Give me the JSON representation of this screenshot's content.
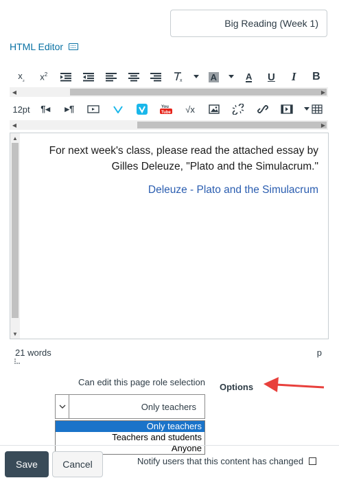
{
  "title_input": {
    "value": "Big Reading (Week 1)"
  },
  "html_editor_link": {
    "label": "HTML Editor",
    "icon": "keyboard-icon"
  },
  "toolbar1": {
    "buttons": [
      {
        "name": "bold-button",
        "label": "B"
      },
      {
        "name": "italic-button",
        "label": "I"
      },
      {
        "name": "underline-button",
        "label": "U"
      },
      {
        "name": "text-color-button",
        "label": "A"
      },
      {
        "name": "background-color-button",
        "label": "A"
      },
      {
        "name": "clear-formatting-button",
        "label": "Tx"
      },
      {
        "name": "align-right-button",
        "icon": "align-right-icon"
      },
      {
        "name": "align-center-button",
        "icon": "align-center-icon"
      },
      {
        "name": "align-left-button",
        "icon": "align-left-icon"
      },
      {
        "name": "outdent-button",
        "icon": "outdent-icon"
      },
      {
        "name": "indent-button",
        "icon": "indent-icon"
      },
      {
        "name": "superscript-button",
        "label": "x²"
      },
      {
        "name": "subscript-button",
        "label": "x₂"
      }
    ]
  },
  "toolbar2": {
    "font_size": "12pt",
    "buttons": [
      {
        "name": "table-button",
        "icon": "table-icon"
      },
      {
        "name": "media-button",
        "icon": "media-icon"
      },
      {
        "name": "link-button",
        "icon": "link-icon"
      },
      {
        "name": "unlink-button",
        "icon": "unlink-icon"
      },
      {
        "name": "image-button",
        "icon": "image-icon"
      },
      {
        "name": "equation-button",
        "label": "√x"
      },
      {
        "name": "youtube-button",
        "icon": "youtube-icon"
      },
      {
        "name": "vimeo-button",
        "icon": "vimeo-icon"
      },
      {
        "name": "vimeo-alt-button",
        "icon": "vimeo-v-icon"
      },
      {
        "name": "embed-button",
        "icon": "embed-icon"
      },
      {
        "name": "rtl-button",
        "icon": "rtl-icon"
      },
      {
        "name": "ltr-button",
        "icon": "ltr-icon"
      }
    ]
  },
  "editor": {
    "paragraph": "For next week's class, please read the attached essay by Gilles Deleuze, \"Plato and the Simulacrum.\"",
    "link": "Deleuze - Plato and the Simulacrum"
  },
  "statusbar": {
    "element_path": "p",
    "word_count": "21 words"
  },
  "options": {
    "label": "Options",
    "role_label": "Can edit this page role selection",
    "selected": "Only teachers",
    "choices": [
      "Only teachers",
      "Teachers and students",
      "Anyone"
    ]
  },
  "notify": {
    "label": "Notify users that this content has changed"
  },
  "buttons": {
    "cancel": "Cancel",
    "save": "Save"
  },
  "colors": {
    "link": "#0770a3",
    "save_bg": "#394b58",
    "selected_option": "#1a73c9",
    "arrow": "#e8403c"
  }
}
